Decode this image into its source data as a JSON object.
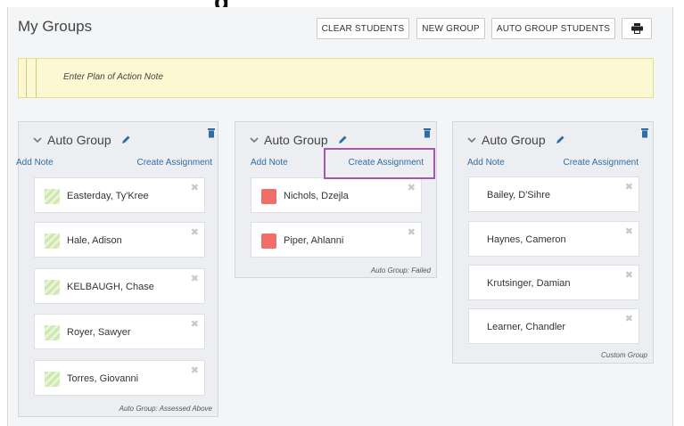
{
  "header": {
    "fragment": "g",
    "title": "My Groups",
    "buttons": {
      "clear_students": "CLEAR STUDENTS",
      "new_group": "NEW GROUP",
      "auto_group": "AUTO GROUP STUDENTS"
    },
    "print_icon": "printer-icon"
  },
  "note_bar": {
    "placeholder": "Enter Plan of Action Note"
  },
  "groups": [
    {
      "title": "Auto Group",
      "add_note": "Add Note",
      "create_assignment": "Create Assignment",
      "students": [
        {
          "name": "Easterday, Ty'Kree"
        },
        {
          "name": "Hale, Adison"
        },
        {
          "name": "KELBAUGH, Chase"
        },
        {
          "name": "Royer, Sawyer"
        },
        {
          "name": "Torres, Giovanni"
        }
      ],
      "footer": "Auto Group: Assessed Above"
    },
    {
      "title": "Auto Group",
      "add_note": "Add Note",
      "create_assignment": "Create Assignment",
      "students": [
        {
          "name": "Nichols, Dzejla"
        },
        {
          "name": "Piper, Ahlanni"
        }
      ],
      "footer": "Auto Group: Failed"
    },
    {
      "title": "Auto Group",
      "add_note": "Add Note",
      "create_assignment": "Create Assignment",
      "students": [
        {
          "name": "Bailey, D'Sihre"
        },
        {
          "name": "Haynes, Cameron"
        },
        {
          "name": "Krutsinger, Damian"
        },
        {
          "name": "Learner, Chandler"
        }
      ],
      "footer": "Custom Group"
    }
  ],
  "remove_glyph": "✖",
  "colors": {
    "link": "#2e6da4",
    "failed_swatch": "#ef6f68",
    "above_swatch": "#cfe8b0",
    "highlight": "#a05aa8",
    "note_bg": "#fcf8d1"
  }
}
